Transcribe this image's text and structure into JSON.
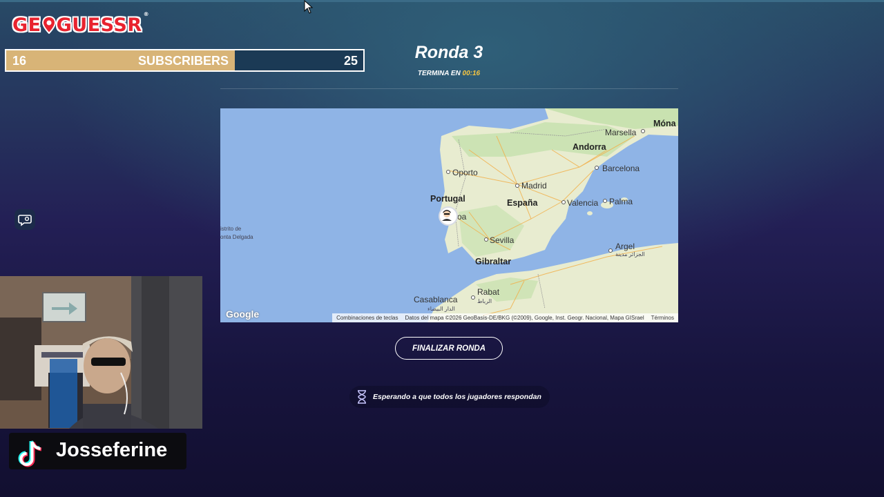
{
  "app": {
    "logo_left": "GE",
    "logo_right": "GUESSR",
    "logo_reg": "®"
  },
  "subscribers": {
    "current": "16",
    "label": "SUBSCRIBERS",
    "goal": "25",
    "progress_fraction": 0.64
  },
  "round": {
    "title": "Ronda 3",
    "ends_label": "TERMINA EN",
    "time_left": "00:16"
  },
  "map": {
    "labels": [
      "Marsella",
      "Móna",
      "Andorra",
      "Oporto",
      "Barcelona",
      "Madrid",
      "Portugal",
      "España",
      "Valencia",
      "Palma",
      "oa",
      "Sevilla",
      "Argel",
      "Gibraltar",
      "Rabat",
      "Casablanca"
    ],
    "tiny_labels": [
      "istrito de",
      "onta Delgada",
      "الجزائر مدينة",
      "الرباط",
      "الدار البيضاء"
    ],
    "attribution": {
      "shortcuts": "Combinaciones de teclas",
      "data": "Datos del mapa ©2026 GeoBasis-DE/BKG (©2009), Google, Inst. Geogr. Nacional, Mapa GISrael",
      "terms": "Términos"
    },
    "google_logo": "Google",
    "colors": {
      "water": "#8fb4e6",
      "land": "#e8ecd0",
      "green": "#c9e2b0"
    }
  },
  "actions": {
    "finalize": "FINALIZAR RONDA"
  },
  "status": {
    "waiting": "Esperando a que todos los jugadores respondan"
  },
  "streamer": {
    "handle": "Josseferine"
  },
  "icons": [
    "pin-icon",
    "chat-icon",
    "hourglass-icon",
    "tiktok-icon",
    "player-avatar-icon",
    "mouse-cursor-icon"
  ]
}
